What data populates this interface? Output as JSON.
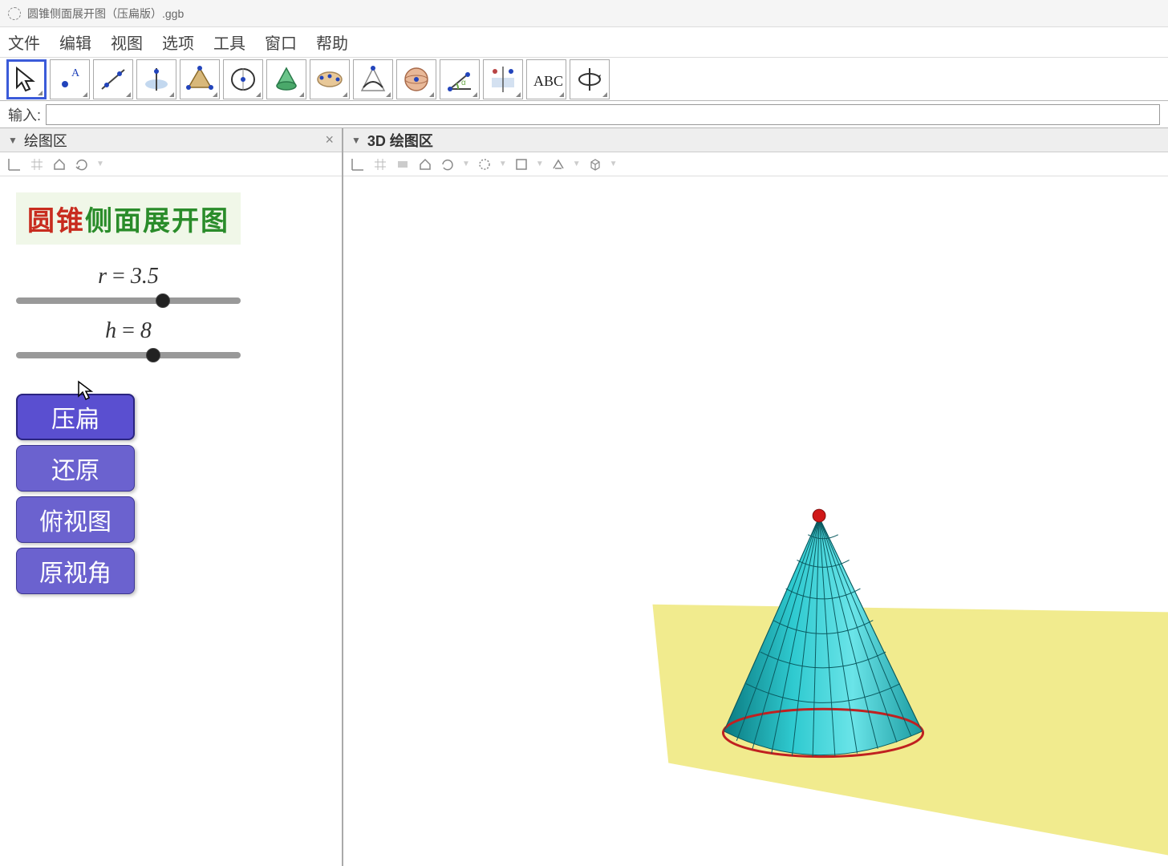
{
  "window": {
    "title": "圆锥侧面展开图（压扁版）.ggb"
  },
  "menu": {
    "items": [
      "文件",
      "编辑",
      "视图",
      "选项",
      "工具",
      "窗口",
      "帮助"
    ]
  },
  "toolbar_icons": [
    "move",
    "point",
    "line",
    "perpendicular",
    "polygon",
    "circle",
    "cone",
    "ellipse",
    "parabola",
    "sphere",
    "angle",
    "reflect",
    "text",
    "rotate"
  ],
  "input": {
    "label": "输入:",
    "value": ""
  },
  "panels": {
    "left": {
      "title": "绘图区",
      "close": "×"
    },
    "right": {
      "title": "3D 绘图区"
    }
  },
  "heading": {
    "part1": "圆锥",
    "part2": "侧面展开图"
  },
  "sliders": {
    "r": {
      "var": "r",
      "value": "3.5",
      "pos": 62
    },
    "h": {
      "var": "h",
      "value": "8",
      "pos": 58
    }
  },
  "buttons": [
    "压扁",
    "还原",
    "俯视图",
    "原视角"
  ],
  "chart_data": {
    "type": "3d-cone",
    "description": "Teal cone on yellow ground plane with red apex point",
    "r": 3.5,
    "h": 8,
    "apex_color": "#d01818",
    "surface_color": "#2fcad0",
    "base_edge_color": "#c02020",
    "plane_color": "#efe87a"
  }
}
